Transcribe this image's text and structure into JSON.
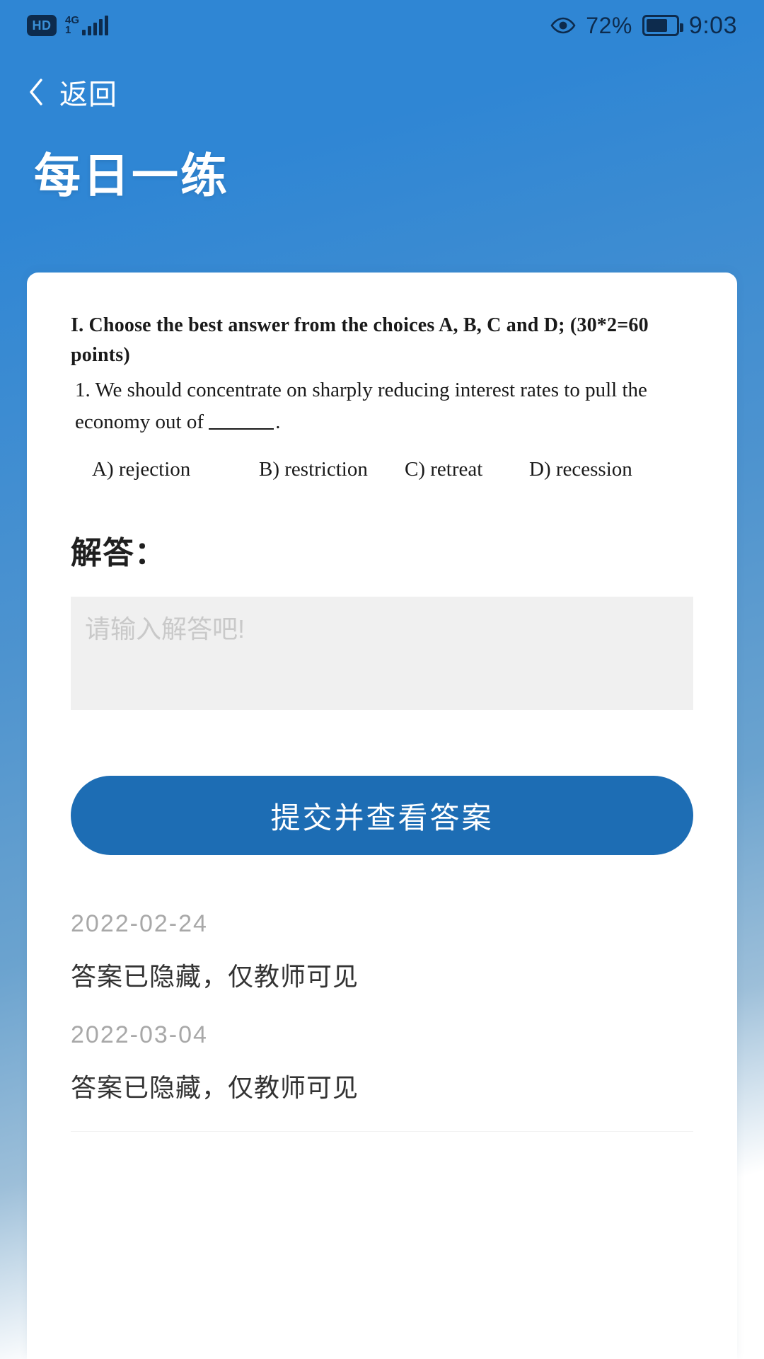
{
  "statusbar": {
    "hd_label": "HD",
    "network_gen": "4G",
    "network_sub": "1",
    "signal_icon": "signal-bars-icon",
    "eye_icon": "eye-comfort-icon",
    "battery_percent": "72%",
    "battery_level": 72,
    "battery_icon": "battery-icon",
    "time": "9:03"
  },
  "nav": {
    "back_icon": "chevron-left-icon",
    "back_label": "返回"
  },
  "header": {
    "title": "每日一练"
  },
  "question": {
    "heading": "I. Choose the best answer from the choices A, B, C and D; (30*2=60  points)",
    "stem_prefix": "1. We should concentrate on sharply reducing interest rates to pull the economy out of",
    "stem_suffix": ".",
    "options": [
      "A) rejection",
      "B) restriction",
      "C) retreat",
      "D) recession"
    ]
  },
  "answer": {
    "label": "解答：",
    "input_value": "",
    "placeholder": "请输入解答吧!"
  },
  "submit": {
    "label": "提交并查看答案"
  },
  "history": [
    {
      "date": "2022-02-24",
      "text": "答案已隐藏，仅教师可见"
    },
    {
      "date": "2022-03-04",
      "text": "答案已隐藏，仅教师可见"
    }
  ],
  "colors": {
    "brand_blue": "#2f86d4",
    "button_blue": "#1d6db4",
    "status_dark": "#0d2b4d",
    "muted_gray": "#a8a8a8"
  }
}
